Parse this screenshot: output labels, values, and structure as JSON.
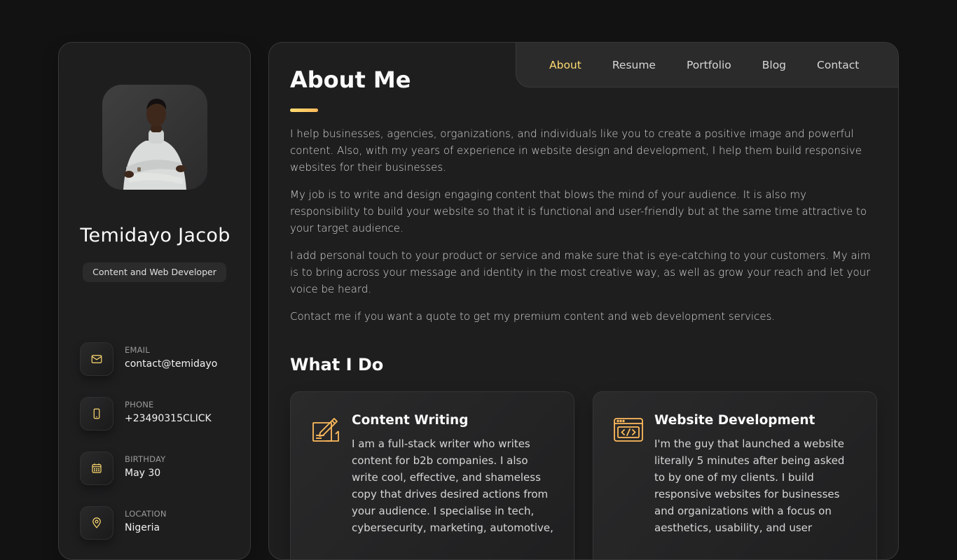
{
  "sidebar": {
    "name": "Temidayo Jacob",
    "title": "Content and Web Developer",
    "contacts": [
      {
        "label": "Email",
        "value": "contact@temidayo",
        "icon": "mail-icon"
      },
      {
        "label": "Phone",
        "value": "+23490315CLICK",
        "icon": "phone-icon"
      },
      {
        "label": "Birthday",
        "value": "May 30",
        "icon": "calendar-icon"
      },
      {
        "label": "Location",
        "value": "Nigeria",
        "icon": "location-pin-icon"
      }
    ]
  },
  "nav": {
    "items": [
      "About",
      "Resume",
      "Portfolio",
      "Blog",
      "Contact"
    ],
    "active": "About"
  },
  "about": {
    "title": "About Me",
    "paragraphs": [
      "I help businesses, agencies, organizations, and individuals like you to create a positive image and powerful content. Also, with my years of experience in website design and development, I help them build responsive websites for their businesses.",
      "My job is to write and design engaging content that blows the mind of your audience. It is also my responsibility to build your website so that it is functional and user-friendly but at the same time attractive to your target audience.",
      "I add personal touch to your product or service and make sure that is eye-catching to your customers. My aim is to bring across your message and identity in the most creative way, as well as grow your reach and let your voice be heard.",
      "Contact me if you want a quote to get my premium content and web development services."
    ]
  },
  "services": {
    "title": "What I Do",
    "items": [
      {
        "title": "Content Writing",
        "icon": "pen-and-paper-icon",
        "text": "I am a full-stack writer who writes content for b2b companies. I also write cool, effective, and shameless copy that drives desired actions from your audience. I specialise in tech, cybersecurity, marketing, automotive,"
      },
      {
        "title": "Website Development",
        "icon": "code-window-icon",
        "text": "I'm the guy that launched a website literally 5 minutes after being asked to by one of my clients. I build responsive websites for businesses and organizations with a focus on aesthetics, usability, and user"
      }
    ]
  },
  "colors": {
    "accent": "#ffdb70",
    "background": "#121212",
    "panel": "#1e1e1f"
  }
}
